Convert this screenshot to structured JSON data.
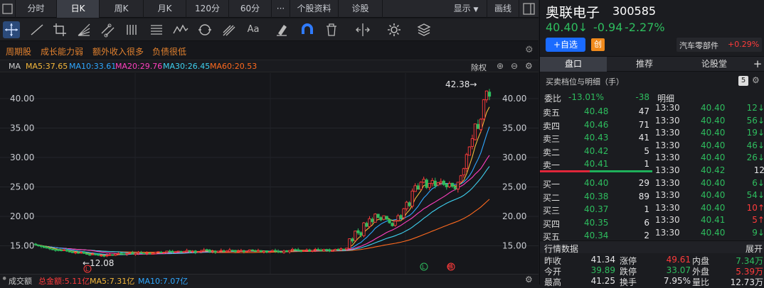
{
  "colors": {
    "up": "#ff3b3b",
    "down": "#2ebd5e",
    "ma5": "#f4b73b",
    "ma10": "#2fa7ff",
    "ma20": "#ff3fbf",
    "ma30": "#3ed1f0",
    "ma60": "#ff6a1f",
    "accent": "#1a6bff"
  },
  "topbar": {
    "tabs": [
      "分时",
      "日K",
      "周K",
      "月K",
      "120分",
      "60分",
      "···",
      "个股资料",
      "诊股"
    ],
    "active_tab": "日K",
    "display_label": "显示",
    "draw_label": "画线"
  },
  "toolbar": {
    "icons": [
      "crosshair-icon",
      "line-icon",
      "crop-icon",
      "fan-icon",
      "channel-icon",
      "bars-icon",
      "list-icon",
      "wave-icon",
      "cycle-icon",
      "fork-icon",
      "text-icon",
      "eraser-icon",
      "magnet-icon",
      "trash-icon",
      "split-icon",
      "settings-icon",
      "layers-icon"
    ],
    "text_tool_label": "Aa"
  },
  "tags": [
    "周期股",
    "成长能力弱",
    "额外收入很多",
    "负债很低"
  ],
  "ma": {
    "title": "MA",
    "ma5": "MA5:37.65",
    "ma10": "MA10:33.61",
    "ma20": "MA20:29.76",
    "ma30": "MA30:26.45",
    "ma60": "MA60:20.53",
    "adjust_label": "除权"
  },
  "chart": {
    "y_ticks_left": [
      "40.00",
      "35.00",
      "30.00",
      "25.00",
      "20.00",
      "15.00"
    ],
    "y_ticks_right": [
      "40.00",
      "35.00",
      "30.00",
      "25.00",
      "20.00",
      "15.00"
    ],
    "high_marker": "42.38→",
    "low_marker": "←12.08",
    "badge_l": "L",
    "badge_l2": "L",
    "badge_red": "轉"
  },
  "chart_data": {
    "type": "candlestick",
    "ylim": [
      12,
      44
    ],
    "grid": true,
    "high": 42.38,
    "low": 12.08,
    "close": [
      15.2,
      15.0,
      14.9,
      14.7,
      14.6,
      14.5,
      14.4,
      14.3,
      14.2,
      14.2,
      14.3,
      14.1,
      14.0,
      13.9,
      13.9,
      13.8,
      13.9,
      13.7,
      13.6,
      13.5,
      13.6,
      13.5,
      13.4,
      13.4,
      13.3,
      13.4,
      13.5,
      13.4,
      13.6,
      13.7,
      13.6,
      13.5,
      13.7,
      13.8,
      13.6,
      13.7,
      13.9,
      13.8,
      13.7,
      13.8,
      13.6,
      13.7,
      13.9,
      14.0,
      13.8,
      13.9,
      14.1,
      14.0,
      13.9,
      14.0,
      14.1,
      13.9,
      14.0,
      14.2,
      14.0,
      14.1,
      13.9,
      14.0,
      14.1,
      14.3,
      14.2,
      14.0,
      14.1,
      13.9,
      14.1,
      14.2,
      14.0,
      14.1,
      14.3,
      14.2,
      14.0,
      14.1,
      14.2,
      14.0,
      14.1,
      14.3,
      14.2,
      14.1,
      14.2,
      14.0,
      14.1,
      13.9,
      14.0,
      14.2,
      14.1,
      14.0,
      13.9,
      14.1,
      14.0,
      14.2,
      14.4,
      14.3,
      14.2,
      14.1,
      14.2,
      14.3,
      14.1,
      14.2,
      14.4,
      14.3,
      14.2,
      14.4,
      14.3,
      14.1,
      14.2,
      14.4,
      14.3,
      14.5,
      14.4,
      14.6,
      16.2,
      15.8,
      17.5,
      17.2,
      16.8,
      18.9,
      18.3,
      19.6,
      19.1,
      20.4,
      19.8,
      19.4,
      20.1,
      19.5,
      18.9,
      18.4,
      19.2,
      20.1,
      19.7,
      21.3,
      22.4,
      21.8,
      24.3,
      25.2,
      24.6,
      25.8,
      26.3,
      24.9,
      25.6,
      26.1,
      25.2,
      25.7,
      25.9,
      25.4,
      25.0,
      25.6,
      25.1,
      24.7,
      25.8,
      26.9,
      28.1,
      30.5,
      31.8,
      33.2,
      35.7,
      34.9,
      36.5,
      39.8,
      41.3,
      40.4
    ],
    "series": [
      {
        "name": "MA5",
        "last": 37.65
      },
      {
        "name": "MA10",
        "last": 33.61
      },
      {
        "name": "MA20",
        "last": 29.76
      },
      {
        "name": "MA30",
        "last": 26.45
      },
      {
        "name": "MA60",
        "last": 20.53
      }
    ]
  },
  "volume": {
    "label": "成交额",
    "total": "总金额:5.11亿",
    "ma5": "MA5:7.31亿",
    "ma10": "MA10:7.07亿"
  },
  "stock": {
    "name": "奥联电子",
    "code": "300585",
    "price": "40.40↓",
    "change": "-0.94",
    "pct": "-2.27%",
    "add_label": "+自选",
    "chuang_label": "创",
    "sector": "汽车零部件",
    "sector_pct": "+0.29%"
  },
  "rtabs": [
    "盘口",
    "推荐",
    "论股堂",
    "+"
  ],
  "orderbook": {
    "header": "买卖档位与明细（手）",
    "header_badge": "5",
    "weibi_label": "委比",
    "weibi_pct": "-13.01%",
    "weibi_val": "-38",
    "detail_label": "明细",
    "sells": [
      {
        "label": "卖五",
        "price": "40.48",
        "vol": "47"
      },
      {
        "label": "卖四",
        "price": "40.46",
        "vol": "71"
      },
      {
        "label": "卖三",
        "price": "40.43",
        "vol": "41"
      },
      {
        "label": "卖二",
        "price": "40.42",
        "vol": "5"
      },
      {
        "label": "卖一",
        "price": "40.41",
        "vol": "1"
      }
    ],
    "buys": [
      {
        "label": "买一",
        "price": "40.40",
        "vol": "29"
      },
      {
        "label": "买二",
        "price": "40.38",
        "vol": "89"
      },
      {
        "label": "买三",
        "price": "40.37",
        "vol": "1"
      },
      {
        "label": "买四",
        "price": "40.35",
        "vol": "6"
      },
      {
        "label": "买五",
        "price": "40.34",
        "vol": "2"
      }
    ]
  },
  "ticks": [
    {
      "time": "13:30",
      "price": "40.40",
      "vol": "12↓"
    },
    {
      "time": "13:30",
      "price": "40.40",
      "vol": "56↓"
    },
    {
      "time": "13:30",
      "price": "40.40",
      "vol": "19↓"
    },
    {
      "time": "13:30",
      "price": "40.40",
      "vol": "46↓"
    },
    {
      "time": "13:30",
      "price": "40.40",
      "vol": "26↓"
    },
    {
      "time": "13:30",
      "price": "40.42",
      "vol": "12"
    },
    {
      "time": "13:30",
      "price": "40.40",
      "vol": "6↓"
    },
    {
      "time": "13:30",
      "price": "40.40",
      "vol": "54↓"
    },
    {
      "time": "13:30",
      "price": "40.40",
      "vol": "10↑"
    },
    {
      "time": "13:30",
      "price": "40.41",
      "vol": "5↑"
    },
    {
      "time": "13:30",
      "price": "40.40",
      "vol": "9↓"
    }
  ],
  "stats": {
    "title": "行情数据",
    "expand": "展开",
    "rows": [
      [
        {
          "k": "昨收",
          "v": "41.34"
        },
        {
          "k": "涨停",
          "v": "49.61"
        },
        {
          "k": "内盘",
          "v": "7.34万"
        }
      ],
      [
        {
          "k": "今开",
          "v": "39.89"
        },
        {
          "k": "跌停",
          "v": "33.07"
        },
        {
          "k": "外盘",
          "v": "5.39万"
        }
      ],
      [
        {
          "k": "最高",
          "v": "41.25"
        },
        {
          "k": "换手",
          "v": "7.95%"
        },
        {
          "k": "量比",
          "v": "12.73万"
        }
      ]
    ]
  }
}
